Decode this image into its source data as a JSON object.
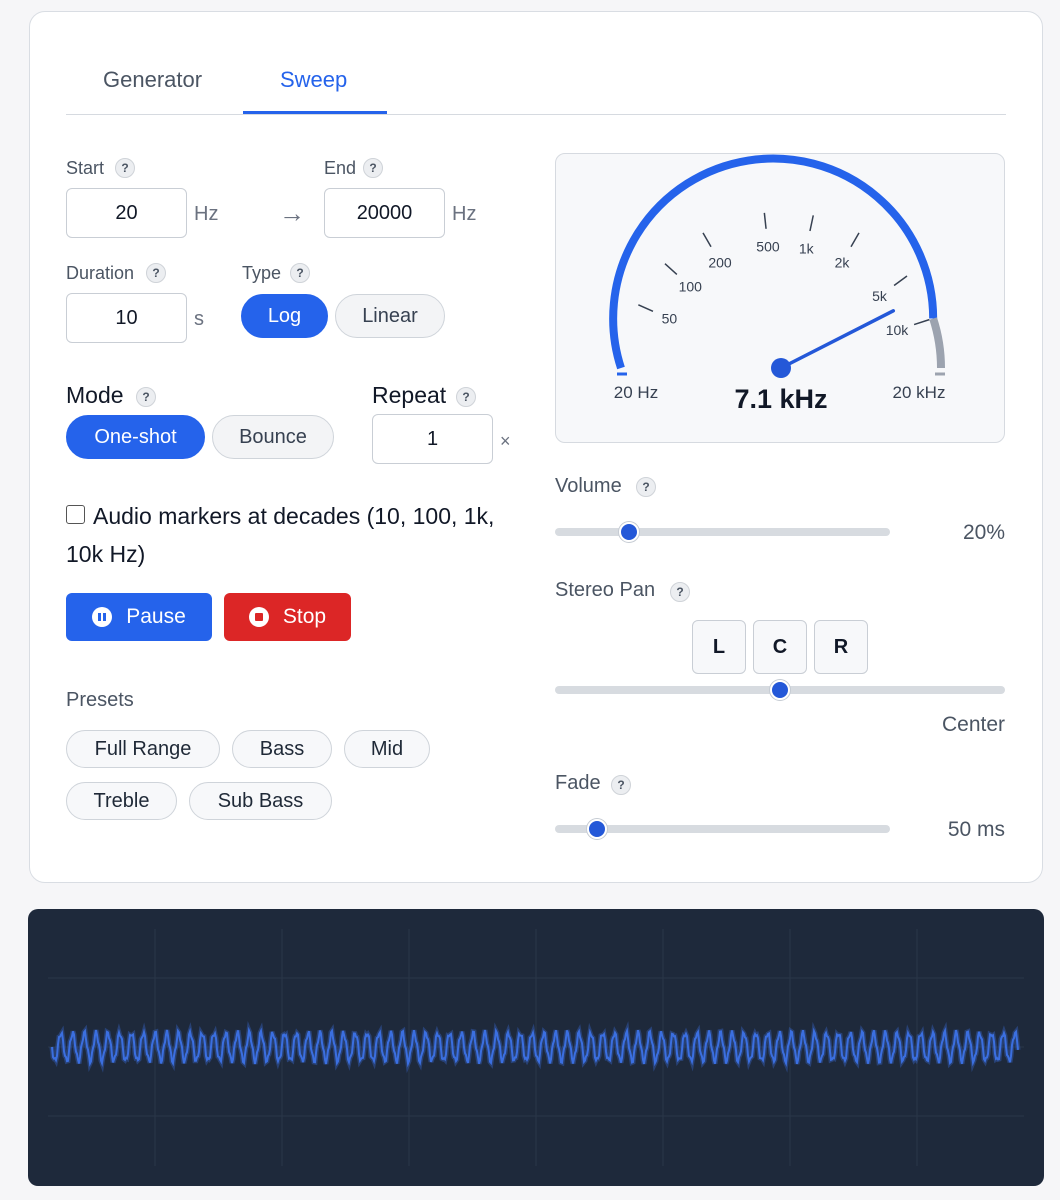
{
  "tabs": [
    {
      "label": "Generator",
      "active": false
    },
    {
      "label": "Sweep",
      "active": true
    }
  ],
  "sweep": {
    "start": {
      "label": "Start",
      "help": "?",
      "value": "20",
      "unit": "Hz"
    },
    "arrow": "→",
    "end": {
      "label": "End",
      "help": "?",
      "value": "20000",
      "unit": "Hz"
    },
    "duration": {
      "label": "Duration",
      "help": "?",
      "value": "10",
      "unit": "s"
    },
    "type": {
      "label": "Type",
      "help": "?",
      "options": [
        "Log",
        "Linear"
      ],
      "selected": "Log"
    },
    "mode": {
      "label": "Mode",
      "help": "?",
      "options": [
        "One-shot",
        "Bounce"
      ],
      "selected": "One-shot"
    },
    "repeat": {
      "label": "Repeat",
      "help": "?",
      "value": "1",
      "unit": "×"
    },
    "markers": {
      "label": "Audio markers at decades (10, 100, 1k,",
      "label2": "10k Hz)",
      "checked": false
    },
    "pause_label": "Pause",
    "stop_label": "Stop",
    "presets": {
      "label": "Presets",
      "items": [
        "Full Range",
        "Bass",
        "Mid",
        "Treble",
        "Sub Bass"
      ]
    }
  },
  "gauge": {
    "readout": "7.1 kHz",
    "min_label": "20 Hz",
    "max_label": "20 kHz",
    "ticks": [
      "50",
      "100",
      "200",
      "500",
      "1k",
      "2k",
      "5k",
      "10k"
    ],
    "tick_values": [
      50,
      100,
      200,
      500,
      1000,
      2000,
      5000,
      10000
    ],
    "min_hz": 20,
    "max_hz": 20000,
    "current_hz": 7100,
    "accent": "#2563eb",
    "track_end": "#9ca3af"
  },
  "volume": {
    "label": "Volume",
    "help": "?",
    "value_text": "20%",
    "level": 0.22
  },
  "pan": {
    "label": "Stereo Pan",
    "help": "?",
    "buttons": [
      "L",
      "C",
      "R"
    ],
    "value_text": "Center",
    "level": 0.5
  },
  "fade": {
    "label": "Fade",
    "help": "?",
    "value_text": "50 ms",
    "level": 0.125
  },
  "colors": {
    "accent": "#2563eb",
    "danger": "#dc2626",
    "scope_bg": "#1e293b",
    "wave": "#3b6fe0"
  }
}
